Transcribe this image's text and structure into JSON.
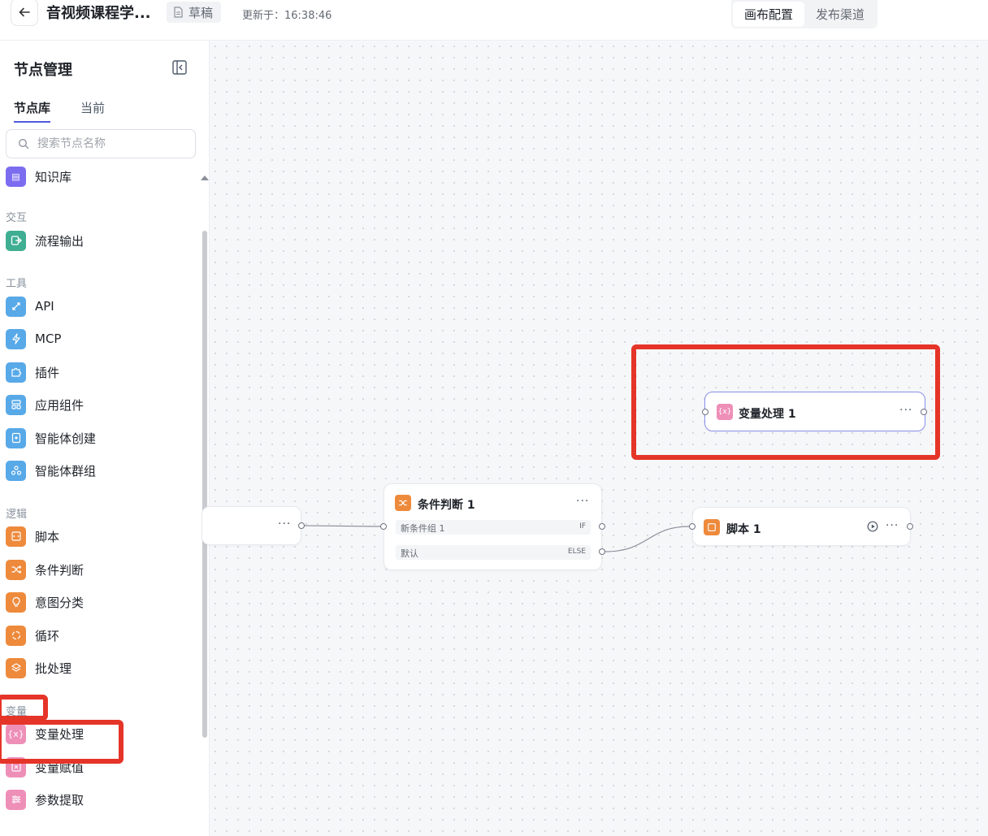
{
  "header": {
    "back_icon": "arrow-left-icon",
    "title": "音视频课程学...",
    "draft_label": "草稿",
    "updated_text": "更新于：16:38:46",
    "segments": [
      {
        "label": "画布配置",
        "active": true
      },
      {
        "label": "发布渠道",
        "active": false
      }
    ]
  },
  "sidebar": {
    "title": "节点管理",
    "tabs": [
      {
        "label": "节点库",
        "active": true
      },
      {
        "label": "当前",
        "active": false
      }
    ],
    "search_placeholder": "搜索节点名称",
    "partial_item": {
      "label": "知识库",
      "color": "#7c6cf0"
    },
    "groups": [
      {
        "label": "交互",
        "items": [
          {
            "label": "流程输出",
            "color": "#3fae93",
            "icon": "export-icon"
          }
        ]
      },
      {
        "label": "工具",
        "items": [
          {
            "label": "API",
            "color": "#58a9e8",
            "icon": "api-link-icon"
          },
          {
            "label": "MCP",
            "color": "#58a9e8",
            "icon": "lightning-icon"
          },
          {
            "label": "插件",
            "color": "#58a9e8",
            "icon": "puzzle-icon"
          },
          {
            "label": "应用组件",
            "color": "#58a9e8",
            "icon": "layout-icon"
          },
          {
            "label": "智能体创建",
            "color": "#58a9e8",
            "icon": "agent-create-icon"
          },
          {
            "label": "智能体群组",
            "color": "#58a9e8",
            "icon": "agent-group-icon"
          }
        ]
      },
      {
        "label": "逻辑",
        "items": [
          {
            "label": "脚本",
            "color": "#ee8a3c",
            "icon": "script-icon"
          },
          {
            "label": "条件判断",
            "color": "#ee8a3c",
            "icon": "shuffle-icon"
          },
          {
            "label": "意图分类",
            "color": "#ee8a3c",
            "icon": "bulb-icon"
          },
          {
            "label": "循环",
            "color": "#ee8a3c",
            "icon": "loop-icon"
          },
          {
            "label": "批处理",
            "color": "#ee8a3c",
            "icon": "layers-icon"
          }
        ]
      },
      {
        "label": "变量",
        "items": [
          {
            "label": "变量处理",
            "color": "#ee8fb8",
            "icon": "variable-icon"
          },
          {
            "label": "变量赋值",
            "color": "#ee8fb8",
            "icon": "assign-icon"
          },
          {
            "label": "参数提取",
            "color": "#ee8fb8",
            "icon": "sliders-icon"
          }
        ]
      }
    ]
  },
  "canvas": {
    "var_node": {
      "title": "变量处理 1",
      "icon_text": "{x}",
      "color": "#ee8fb8"
    },
    "cond_node": {
      "title": "条件判断 1",
      "color": "#ee8a3c",
      "rows": [
        {
          "text": "新条件组 1",
          "tag": "IF"
        },
        {
          "text": "默认",
          "tag": "ELSE"
        }
      ]
    },
    "script_node": {
      "title": "脚本 1",
      "color": "#ee8a3c"
    },
    "more_label": "···"
  }
}
